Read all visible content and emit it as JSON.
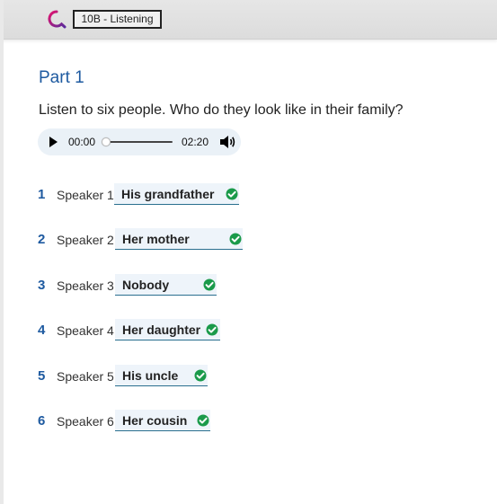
{
  "header": {
    "activity_tag": "10B - Listening"
  },
  "main": {
    "part_title": "Part 1",
    "instruction": "Listen to six people. Who do they look like in their family?",
    "player": {
      "current_time": "00:00",
      "total_time": "02:20",
      "progress": 0
    },
    "questions": [
      {
        "number": "1",
        "speaker": "Speaker 1",
        "answer": "His grandfather"
      },
      {
        "number": "2",
        "speaker": "Speaker 2",
        "answer": "Her mother"
      },
      {
        "number": "3",
        "speaker": "Speaker 3",
        "answer": "Nobody"
      },
      {
        "number": "4",
        "speaker": "Speaker 4",
        "answer": "Her daughter"
      },
      {
        "number": "5",
        "speaker": "Speaker 5",
        "answer": "His uncle"
      },
      {
        "number": "6",
        "speaker": "Speaker 6",
        "answer": "Her cousin"
      }
    ]
  },
  "colors": {
    "accent": "#1e5aa0",
    "check_green": "#1a9a4a",
    "answer_bg": "#eef4fa"
  },
  "icons": {
    "logo": "q-logo-icon",
    "play": "play-icon",
    "volume": "volume-icon",
    "correct": "check-circle-icon"
  }
}
